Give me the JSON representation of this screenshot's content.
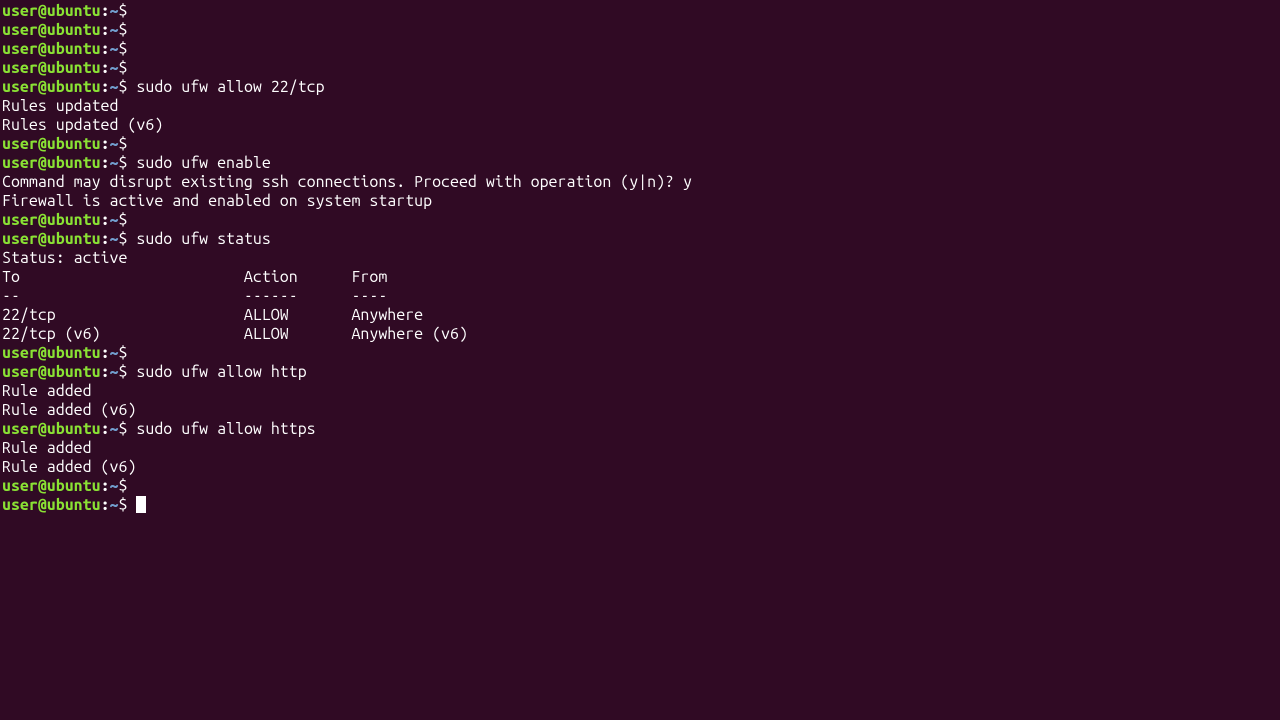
{
  "prompt": {
    "user_host": "user@ubuntu",
    "colon": ":",
    "path": "~",
    "dollar": "$"
  },
  "lines": {
    "cmd1": " sudo ufw allow 22/tcp",
    "out1a": "Rules updated",
    "out1b": "Rules updated (v6)",
    "cmd2": " sudo ufw enable",
    "out2a": "Command may disrupt existing ssh connections. Proceed with operation (y|n)? y",
    "out2b": "Firewall is active and enabled on system startup",
    "cmd3": " sudo ufw status",
    "out3a": "Status: active",
    "out3b": "",
    "out3c": "To                         Action      From",
    "out3d": "--                         ------      ----",
    "out3e": "22/tcp                     ALLOW       Anywhere                  ",
    "out3f": "22/tcp (v6)                ALLOW       Anywhere (v6)             ",
    "out3g": "",
    "cmd4": " sudo ufw allow http",
    "out4a": "Rule added",
    "out4b": "Rule added (v6)",
    "cmd5": " sudo ufw allow https",
    "out5a": "Rule added",
    "out5b": "Rule added (v6)",
    "empty": " "
  }
}
